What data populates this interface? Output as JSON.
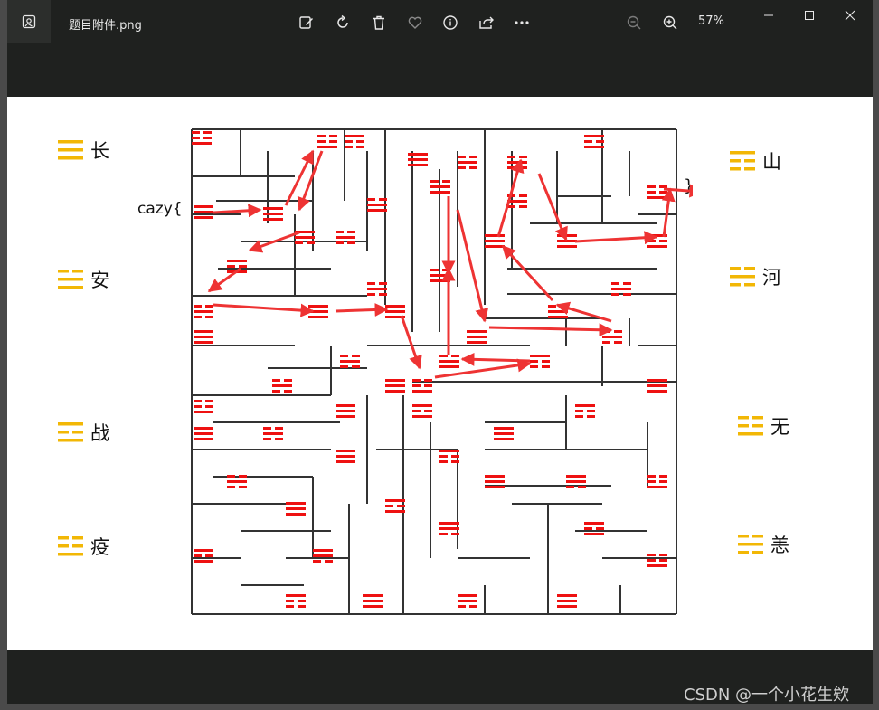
{
  "window": {
    "filename": "题目附件.png",
    "zoom": "57%"
  },
  "toolbar": {
    "icons": [
      "edit-image-icon",
      "rotate-icon",
      "delete-icon",
      "favorite-heart-icon",
      "info-icon",
      "share-icon",
      "more-icon",
      "zoom-out-icon",
      "zoom-in-icon"
    ]
  },
  "window_controls": [
    "minimize-icon",
    "maximize-icon",
    "close-icon"
  ],
  "image": {
    "prefix": "cazy{",
    "suffix": "}",
    "left_labels": [
      "长",
      "安",
      "战",
      "疫"
    ],
    "right_labels": [
      "山",
      "河",
      "无",
      "恙"
    ],
    "trigram_color": "#f2b705",
    "maze_symbol_color": "#ee1111",
    "arrow_color": "#ee3333"
  },
  "watermark": "CSDN @一个小花生欸"
}
